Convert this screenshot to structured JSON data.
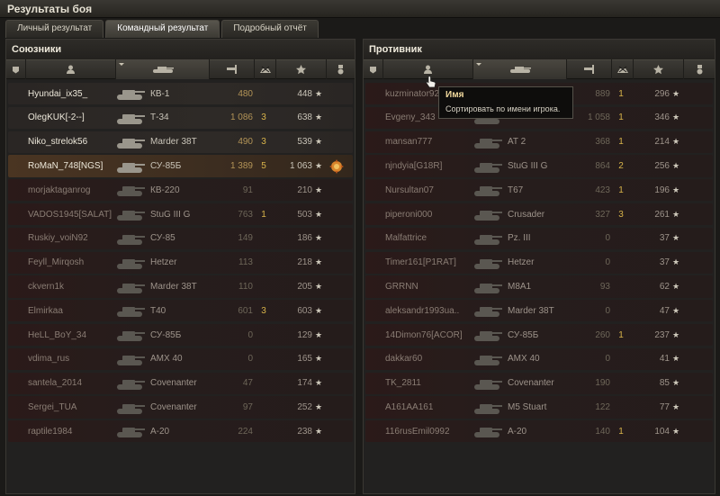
{
  "window": {
    "title": "Результаты боя"
  },
  "tabs": [
    {
      "label": "Личный результат"
    },
    {
      "label": "Командный результат"
    },
    {
      "label": "Подробный отчёт"
    }
  ],
  "allies": {
    "title": "Союзники",
    "rows": [
      {
        "name": "Hyundai_ix35_",
        "tank": "КВ-1",
        "damage": "480",
        "kills": "",
        "xp": "448"
      },
      {
        "name": "OlegKUK[-2--]",
        "tank": "Т-34",
        "damage": "1 086",
        "kills": "3",
        "xp": "638"
      },
      {
        "name": "Niko_strelok56",
        "tank": "Marder 38T",
        "damage": "490",
        "kills": "3",
        "xp": "539"
      },
      {
        "name": "RoMaN_748[NGS]",
        "tank": "СУ-85Б",
        "damage": "1 389",
        "kills": "5",
        "xp": "1 063"
      },
      {
        "name": "morjaktaganrog",
        "tank": "КВ-220",
        "damage": "91",
        "kills": "",
        "xp": "210"
      },
      {
        "name": "VADOS1945[SALAT]",
        "tank": "StuG III G",
        "damage": "763",
        "kills": "1",
        "xp": "503"
      },
      {
        "name": "Ruskiy_voiN92",
        "tank": "СУ-85",
        "damage": "149",
        "kills": "",
        "xp": "186"
      },
      {
        "name": "Feyll_Mirqosh",
        "tank": "Hetzer",
        "damage": "113",
        "kills": "",
        "xp": "218"
      },
      {
        "name": "ckvern1k",
        "tank": "Marder 38T",
        "damage": "110",
        "kills": "",
        "xp": "205"
      },
      {
        "name": "Elmirkaa",
        "tank": "T40",
        "damage": "601",
        "kills": "3",
        "xp": "603"
      },
      {
        "name": "HeLL_BoY_34",
        "tank": "СУ-85Б",
        "damage": "0",
        "kills": "",
        "xp": "129"
      },
      {
        "name": "vdima_rus",
        "tank": "AMX 40",
        "damage": "0",
        "kills": "",
        "xp": "165"
      },
      {
        "name": "santela_2014",
        "tank": "Covenanter",
        "damage": "47",
        "kills": "",
        "xp": "174"
      },
      {
        "name": "Sergei_TUA",
        "tank": "Covenanter",
        "damage": "97",
        "kills": "",
        "xp": "252"
      },
      {
        "name": "raptile1984",
        "tank": "А-20",
        "damage": "224",
        "kills": "",
        "xp": "238"
      }
    ]
  },
  "enemies": {
    "title": "Противник",
    "rows": [
      {
        "name": "kuzminator92",
        "tank": "",
        "damage": "889",
        "kills": "1",
        "xp": "296"
      },
      {
        "name": "Evgeny_343",
        "tank": "",
        "damage": "1 058",
        "kills": "1",
        "xp": "346"
      },
      {
        "name": "mansan777",
        "tank": "AT 2",
        "damage": "368",
        "kills": "1",
        "xp": "214"
      },
      {
        "name": "njndyia[G18R]",
        "tank": "StuG III G",
        "damage": "864",
        "kills": "2",
        "xp": "256"
      },
      {
        "name": "Nursultan07",
        "tank": "T67",
        "damage": "423",
        "kills": "1",
        "xp": "196"
      },
      {
        "name": "piperoni000",
        "tank": "Crusader",
        "damage": "327",
        "kills": "3",
        "xp": "261"
      },
      {
        "name": "Malfattrice",
        "tank": "Pz. III",
        "damage": "0",
        "kills": "",
        "xp": "37"
      },
      {
        "name": "Timer161[P1RAT]",
        "tank": "Hetzer",
        "damage": "0",
        "kills": "",
        "xp": "37"
      },
      {
        "name": "GRRNN",
        "tank": "M8A1",
        "damage": "93",
        "kills": "",
        "xp": "62"
      },
      {
        "name": "aleksandr1993ua..",
        "tank": "Marder 38T",
        "damage": "0",
        "kills": "",
        "xp": "47"
      },
      {
        "name": "14Dimon76[ACOR]",
        "tank": "СУ-85Б",
        "damage": "260",
        "kills": "1",
        "xp": "237"
      },
      {
        "name": "dakkar60",
        "tank": "AMX 40",
        "damage": "0",
        "kills": "",
        "xp": "41"
      },
      {
        "name": "TK_2811",
        "tank": "Covenanter",
        "damage": "190",
        "kills": "",
        "xp": "85"
      },
      {
        "name": "A161AA161",
        "tank": "M5 Stuart",
        "damage": "122",
        "kills": "",
        "xp": "77"
      },
      {
        "name": "116rusEmil0992",
        "tank": "А-20",
        "damage": "140",
        "kills": "1",
        "xp": "104"
      }
    ]
  },
  "tooltip": {
    "title": "Имя",
    "body": "Сортировать по имени игрока."
  },
  "star_glyph": "★"
}
